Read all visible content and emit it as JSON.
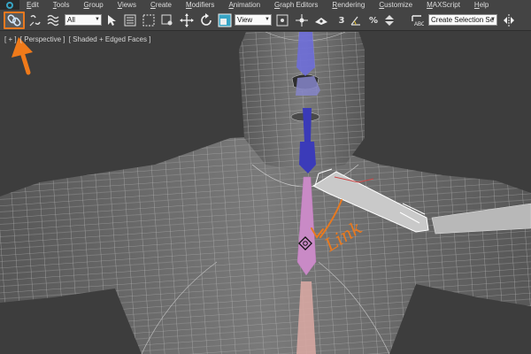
{
  "menu": {
    "items": [
      "Edit",
      "Tools",
      "Group",
      "Views",
      "Create",
      "Modifiers",
      "Animation",
      "Graph Editors",
      "Rendering",
      "Customize",
      "MAXScript",
      "Help"
    ]
  },
  "toolbar": {
    "filter_value": "All",
    "coord_value": "View",
    "selection_set_placeholder": "Create Selection Se",
    "snap_label": "3",
    "snap_angle_label": "%"
  },
  "viewport": {
    "label_plus": "[ + ]",
    "label_view": "[ Perspective ]",
    "label_shading": "[ Shaded + Edged Faces ]"
  },
  "annotation": {
    "text": "Link",
    "color": "#e8791f"
  }
}
